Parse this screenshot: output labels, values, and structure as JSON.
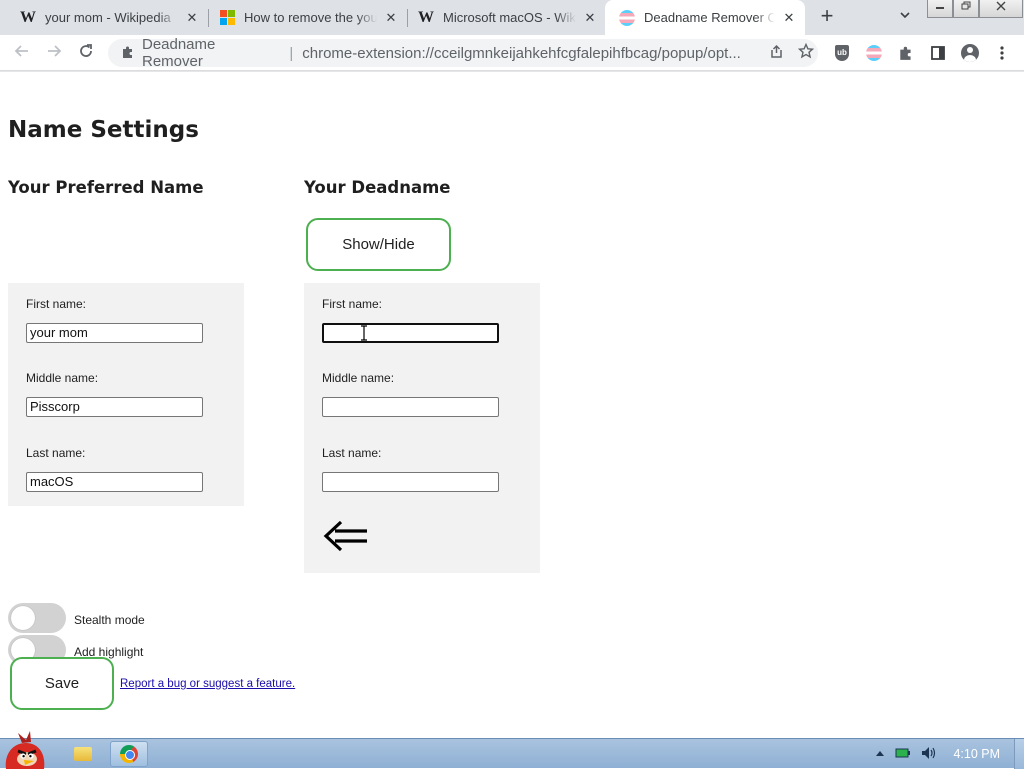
{
  "browser": {
    "tabs": [
      {
        "title": "your mom - Wikipedia",
        "icon": "wikipedia-icon",
        "active": false
      },
      {
        "title": "How to remove the you",
        "icon": "microsoft-icon",
        "active": false
      },
      {
        "title": "Microsoft macOS - Wik",
        "icon": "wikipedia-icon",
        "active": false
      },
      {
        "title": "Deadname Remover Op",
        "icon": "trans-flag-icon",
        "active": true
      }
    ],
    "close_glyph": "✕",
    "new_tab_glyph": "+",
    "omnibox": {
      "site_name": "Deadname Remover",
      "separator": "|",
      "url": "chrome-extension://cceilgmnkeijahkehfcgfalepihfbcag/popup/opt..."
    }
  },
  "page": {
    "title": "Name Settings",
    "preferred": {
      "heading": "Your Preferred Name",
      "first_label": "First name:",
      "first_value": "your mom",
      "middle_label": "Middle name:",
      "middle_value": "Pisscorp",
      "last_label": "Last name:",
      "last_value": "macOS"
    },
    "deadname": {
      "heading": "Your Deadname",
      "show_hide_label": "Show/Hide",
      "first_label": "First name:",
      "first_value": "",
      "middle_label": "Middle name:",
      "middle_value": "",
      "last_label": "Last name:",
      "last_value": ""
    },
    "stealth_label": "Stealth mode",
    "stealth_on": false,
    "highlight_label": "Add highlight",
    "highlight_on": false,
    "save_label": "Save",
    "bug_link": "Report a bug or suggest a feature."
  },
  "taskbar": {
    "clock": "4:10 PM"
  },
  "colors": {
    "button_border": "#4caf50",
    "panel_bg": "#f2f2f2",
    "link": "#1a0dab"
  }
}
